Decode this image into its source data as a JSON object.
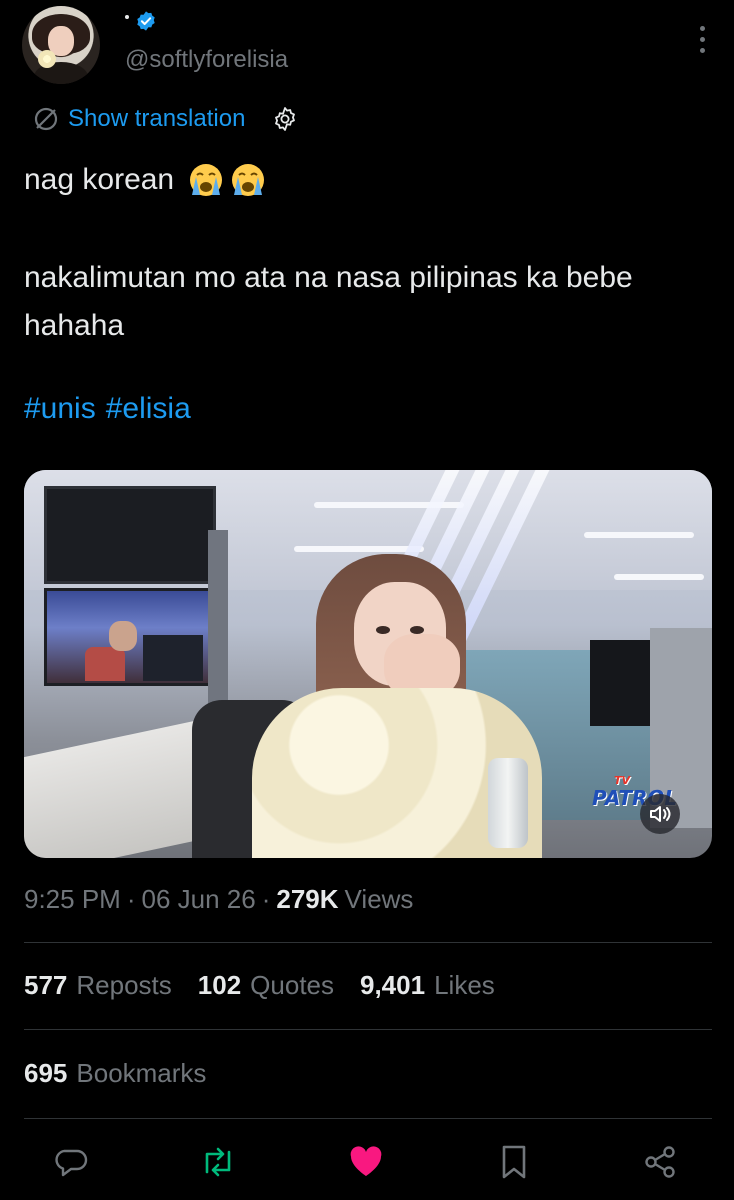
{
  "author": {
    "handle": "@softlyforelisia",
    "verified_color": "#1d9bf0"
  },
  "translate": {
    "label": "Show translation"
  },
  "tweet": {
    "line1": "nag korean",
    "line1_emojis": [
      "loudly-crying-face",
      "loudly-crying-face"
    ],
    "line2": "nakalimutan mo ata na nasa pilipinas ka bebe hahaha",
    "hashtags": [
      "#unis",
      "#elisia"
    ]
  },
  "media": {
    "type": "video",
    "logo_small": "TV",
    "logo_main": "PATROL",
    "mute_icon": "speaker-muted-icon"
  },
  "meta": {
    "time": "9:25 PM",
    "date": "06 Jun 26",
    "views_count": "279K",
    "views_label": "Views"
  },
  "stats": {
    "reposts_count": "577",
    "reposts_label": "Reposts",
    "quotes_count": "102",
    "quotes_label": "Quotes",
    "likes_count": "9,401",
    "likes_label": "Likes",
    "bookmarks_count": "695",
    "bookmarks_label": "Bookmarks"
  },
  "actions": [
    {
      "name": "reply",
      "icon": "chat-bubble-icon",
      "color": "#71767b"
    },
    {
      "name": "repost",
      "icon": "repost-icon",
      "color": "#00ba7c"
    },
    {
      "name": "like",
      "icon": "heart-icon",
      "color": "#f91880"
    },
    {
      "name": "bookmark",
      "icon": "bookmark-icon",
      "color": "#71767b"
    },
    {
      "name": "share",
      "icon": "share-icon",
      "color": "#71767b"
    }
  ],
  "colors": {
    "background": "#000000",
    "text": "#e7e9ea",
    "muted": "#71767b",
    "link": "#1d9bf0"
  }
}
